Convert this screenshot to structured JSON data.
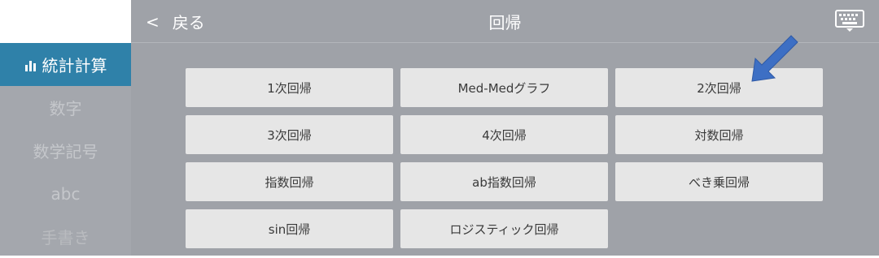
{
  "sidebar": {
    "items": [
      {
        "label": "統計計算",
        "icon": "bar-chart-icon",
        "active": true
      },
      {
        "label": "数字"
      },
      {
        "label": "数学記号"
      },
      {
        "label": "abc"
      },
      {
        "label": "手書き"
      }
    ]
  },
  "header": {
    "back_chevron": "<",
    "back_label": "戻る",
    "title": "回帰",
    "keyboard_icon": "keyboard-icon"
  },
  "buttons": [
    {
      "label": "1次回帰"
    },
    {
      "label": "Med-Medグラフ"
    },
    {
      "label": "2次回帰"
    },
    {
      "label": "3次回帰"
    },
    {
      "label": "4次回帰"
    },
    {
      "label": "対数回帰"
    },
    {
      "label": "指数回帰"
    },
    {
      "label": "ab指数回帰"
    },
    {
      "label": "べき乗回帰"
    },
    {
      "label": "sin回帰"
    },
    {
      "label": "ロジスティック回帰"
    }
  ],
  "colors": {
    "overlay": "#9fa2a8",
    "sidebar_active": "#2f81a9",
    "button_bg": "#e6e6e6",
    "arrow": "#3d6fc4"
  }
}
